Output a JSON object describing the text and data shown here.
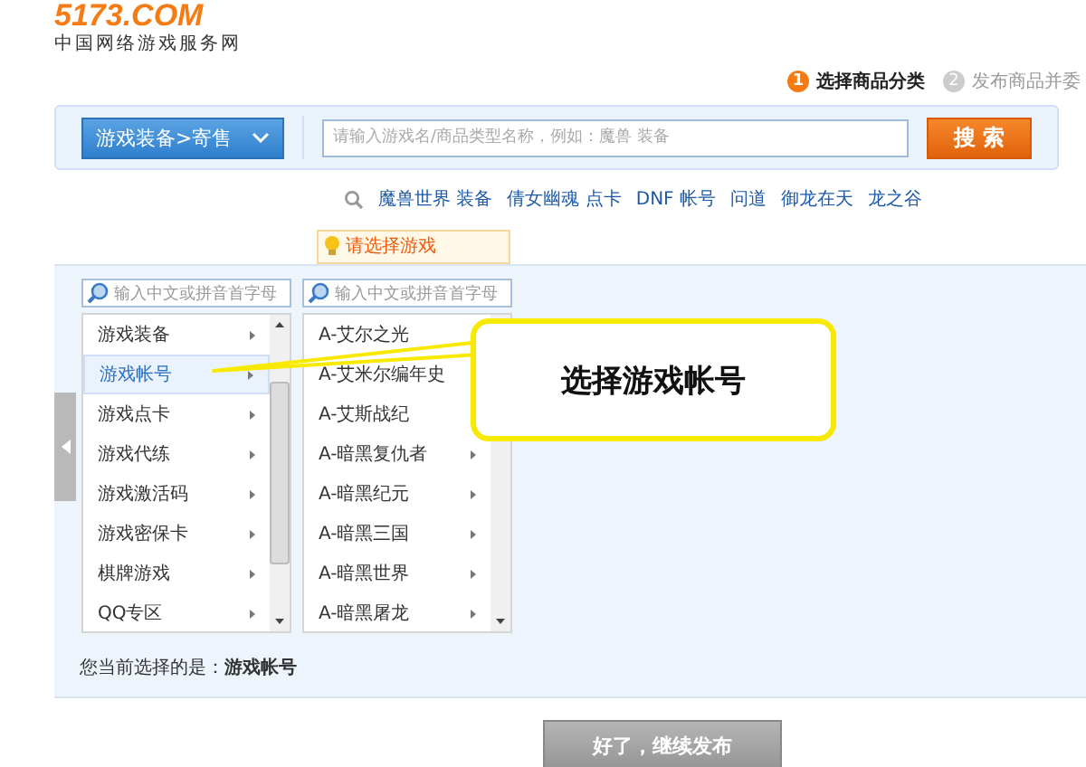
{
  "logo": {
    "brand": "5173.COM",
    "tagline": "中国网络游戏服务网"
  },
  "steps": [
    {
      "number": "1",
      "label": "选择商品分类",
      "selected": true
    },
    {
      "number": "2",
      "label": "发布商品并委",
      "selected": false
    }
  ],
  "search": {
    "category": "游戏装备>寄售",
    "placeholder": "请输入游戏名/商品类型名称，例如：魔兽 装备",
    "button": "搜 索"
  },
  "hot_links": [
    "魔兽世界 装备",
    "倩女幽魂 点卡",
    "DNF 帐号",
    "问道",
    "御龙在天",
    "龙之谷"
  ],
  "tip": "请选择游戏",
  "columns": [
    {
      "filter_placeholder": "输入中文或拼音首字母",
      "items": [
        {
          "label": "游戏装备",
          "has_children": true,
          "selected": false
        },
        {
          "label": "游戏帐号",
          "has_children": true,
          "selected": true
        },
        {
          "label": "游戏点卡",
          "has_children": true,
          "selected": false
        },
        {
          "label": "游戏代练",
          "has_children": true,
          "selected": false
        },
        {
          "label": "游戏激活码",
          "has_children": true,
          "selected": false
        },
        {
          "label": "游戏密保卡",
          "has_children": true,
          "selected": false
        },
        {
          "label": "棋牌游戏",
          "has_children": true,
          "selected": false
        },
        {
          "label": "QQ专区",
          "has_children": true,
          "selected": false
        }
      ]
    },
    {
      "filter_placeholder": "输入中文或拼音首字母",
      "items": [
        {
          "label": "A-艾尔之光",
          "has_children": false,
          "selected": false
        },
        {
          "label": "A-艾米尔编年史",
          "has_children": false,
          "selected": false
        },
        {
          "label": "A-艾斯战纪",
          "has_children": false,
          "selected": false
        },
        {
          "label": "A-暗黑复仇者",
          "has_children": true,
          "selected": false
        },
        {
          "label": "A-暗黑纪元",
          "has_children": true,
          "selected": false
        },
        {
          "label": "A-暗黑三国",
          "has_children": true,
          "selected": false
        },
        {
          "label": "A-暗黑世界",
          "has_children": true,
          "selected": false
        },
        {
          "label": "A-暗黑屠龙",
          "has_children": true,
          "selected": false
        }
      ]
    }
  ],
  "callout": "选择游戏帐号",
  "current_selection": "您当前选择的是：**游戏帐号**",
  "continue_button": "好了，继续发布"
}
